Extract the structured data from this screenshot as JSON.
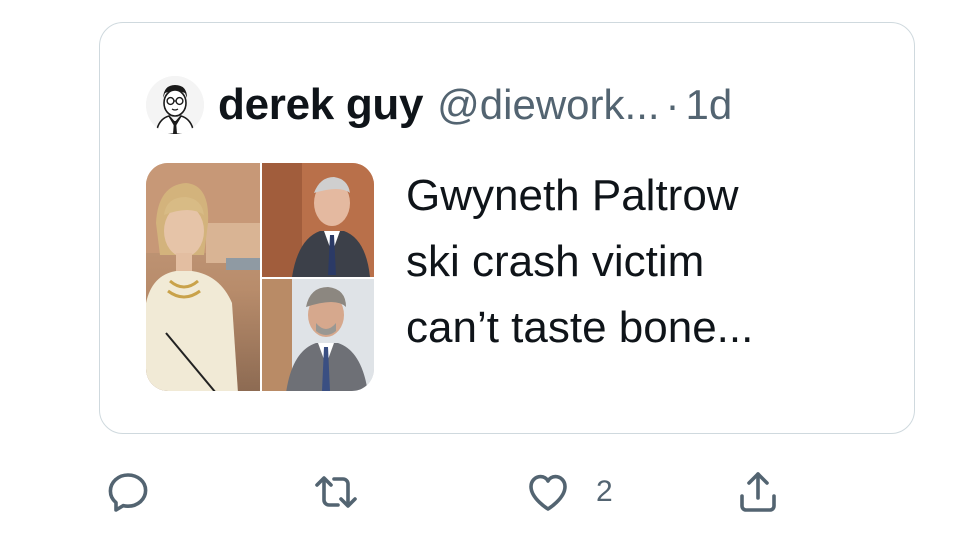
{
  "quote": {
    "author": {
      "display_name": "derek guy",
      "handle": "@diework...",
      "separator": "·",
      "time": "1d",
      "avatar_icon": "avatar-illustration-icon"
    },
    "text_lines": [
      "Gwyneth Paltrow",
      "ski crash victim",
      "can’t taste bone..."
    ],
    "images": [
      "courtroom-woman-photo",
      "courtroom-man-photo",
      "courtroom-lawyer-photo"
    ]
  },
  "actions": {
    "reply_icon": "reply-icon",
    "retweet_icon": "retweet-icon",
    "like_icon": "heart-icon",
    "like_count": "2",
    "share_icon": "share-icon"
  },
  "colors": {
    "text": "#0f1419",
    "secondary": "#536471",
    "border": "#cfd9de"
  }
}
